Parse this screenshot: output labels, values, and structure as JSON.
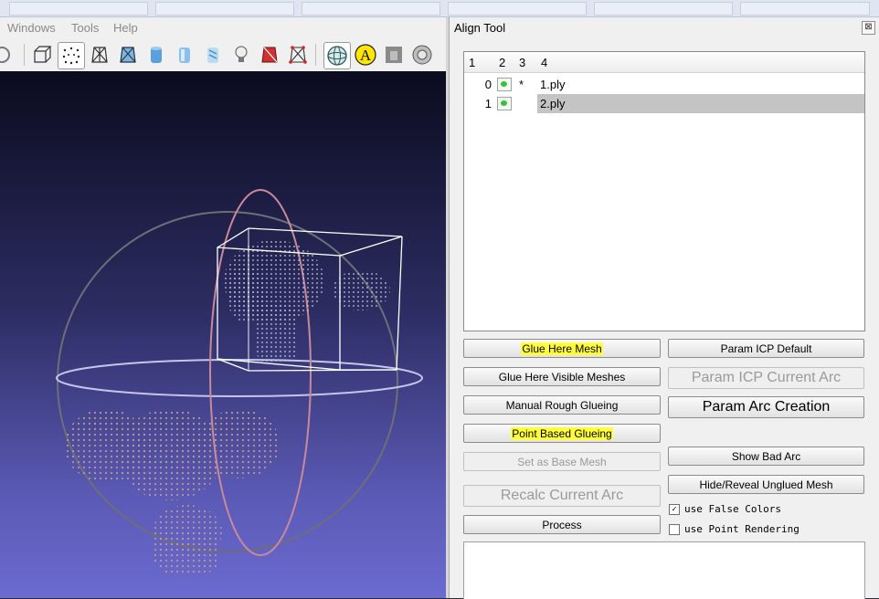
{
  "menu": {
    "windows": "Windows",
    "tools": "Tools",
    "help": "Help"
  },
  "toolbar": {
    "icons": [
      "rotate-icon",
      "bbox-icon",
      "points-icon",
      "wireframe-icon",
      "flat-lines-icon",
      "flat-icon",
      "smooth-icon",
      "texture-icon",
      "light-icon",
      "backface-icon",
      "selection-icon",
      "trackball-icon",
      "annotation-a-icon",
      "layers-icon",
      "snapshot-icon"
    ]
  },
  "panel": {
    "title": "Align Tool",
    "close_glyph": "⊠",
    "tree": {
      "headers": [
        "1",
        "2",
        "3",
        "4"
      ],
      "rows": [
        {
          "index": "0",
          "visible": true,
          "base": "*",
          "name": "1.ply",
          "selected": false
        },
        {
          "index": "1",
          "visible": true,
          "base": "",
          "name": "2.ply",
          "selected": true
        }
      ]
    },
    "buttons": {
      "glue_here_mesh": "Glue Here Mesh",
      "glue_here_visible": "Glue Here Visible Meshes",
      "manual_rough": "Manual Rough Glueing",
      "point_based": "Point Based Glueing",
      "set_base": "Set as Base Mesh",
      "recalc_arc": "Recalc Current Arc",
      "process": "Process",
      "param_icp_default": "Param ICP Default",
      "param_icp_current": "Param ICP Current Arc",
      "param_arc_creation": "Param Arc Creation",
      "show_bad_arc": "Show Bad Arc",
      "hide_reveal": "Hide/Reveal Unglued Mesh"
    },
    "checkboxes": {
      "false_colors": {
        "label": "use False Colors",
        "checked": true
      },
      "point_rendering": {
        "label": "use Point Rendering",
        "checked": false
      }
    }
  },
  "colors": {
    "highlight": "#ffff3a",
    "mesh_1": "#c49a86",
    "mesh_2": "#c8c8e0",
    "trackball_vertical": "#c88a9a"
  }
}
